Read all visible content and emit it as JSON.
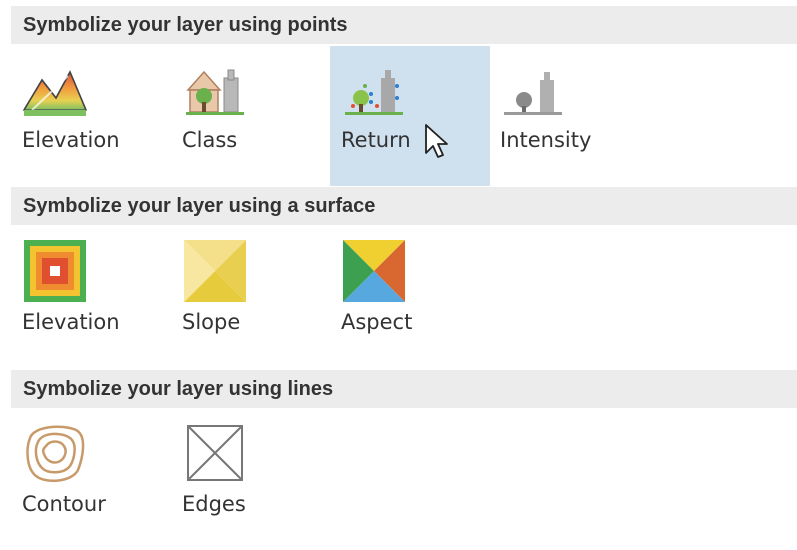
{
  "sections": [
    {
      "title": "Symbolize your layer using points",
      "items": [
        {
          "label": "Elevation",
          "icon": "points-elevation-icon"
        },
        {
          "label": "Class",
          "icon": "points-class-icon"
        },
        {
          "label": "Return",
          "icon": "points-return-icon",
          "selected": true
        },
        {
          "label": "Intensity",
          "icon": "points-intensity-icon"
        }
      ]
    },
    {
      "title": "Symbolize your layer using a surface",
      "items": [
        {
          "label": "Elevation",
          "icon": "surface-elevation-icon"
        },
        {
          "label": "Slope",
          "icon": "surface-slope-icon"
        },
        {
          "label": "Aspect",
          "icon": "surface-aspect-icon"
        }
      ]
    },
    {
      "title": "Symbolize your layer using lines",
      "items": [
        {
          "label": "Contour",
          "icon": "contour-icon"
        },
        {
          "label": "Edges",
          "icon": "edges-icon"
        }
      ]
    }
  ],
  "colors": {
    "header_bg": "#ececec",
    "selected_bg": "#cfe0ef"
  }
}
